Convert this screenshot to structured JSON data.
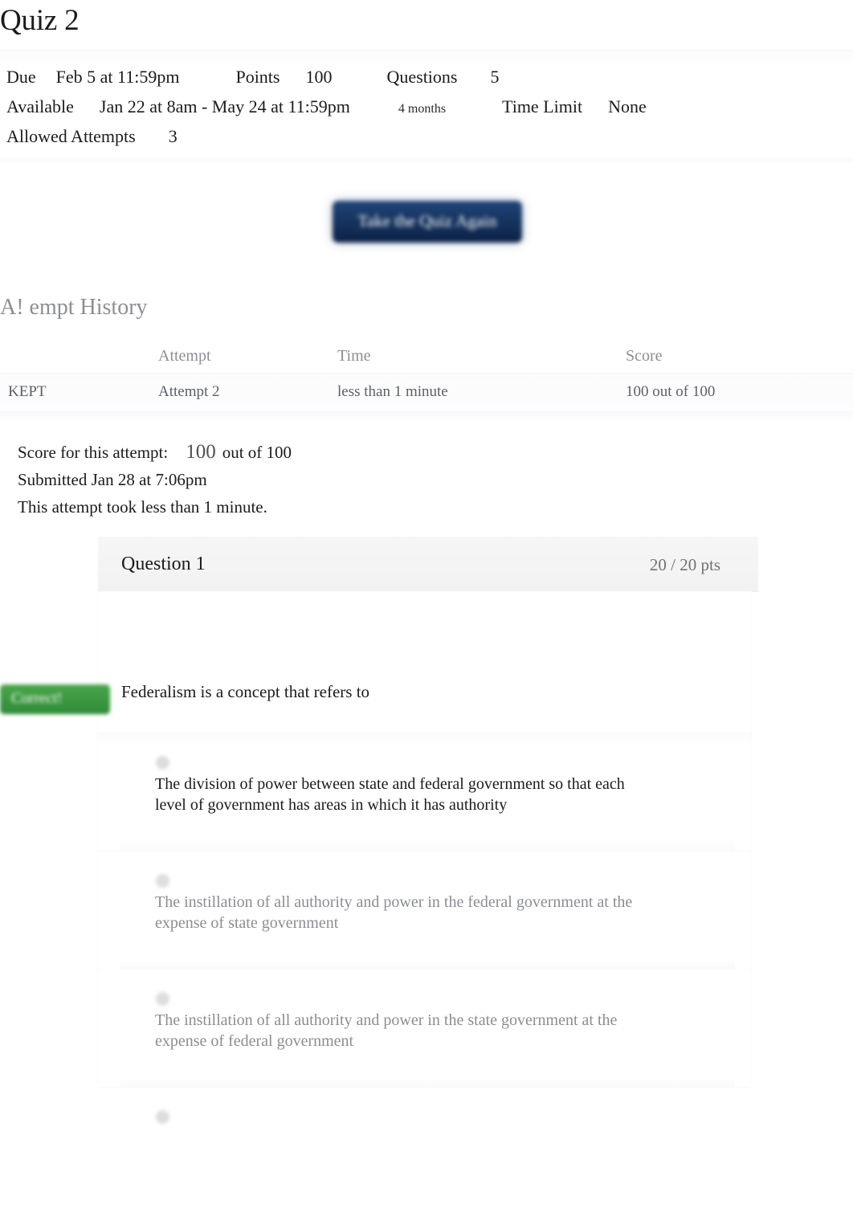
{
  "page": {
    "title": "Quiz 2"
  },
  "details": {
    "due_label": "Due",
    "due_value": "Feb 5 at 11:59pm",
    "points_label": "Points",
    "points_value": "100",
    "questions_label": "Questions",
    "questions_value": "5",
    "available_label": "Available",
    "available_value": "Jan 22 at 8am - May 24 at 11:59pm",
    "duration_note": "4 months",
    "time_limit_label": "Time Limit",
    "time_limit_value": "None",
    "allowed_attempts_label": "Allowed Attempts",
    "allowed_attempts_value": "3"
  },
  "actions": {
    "take_again_label": "Take the Quiz Again"
  },
  "attempt_history": {
    "heading": "A! empt History",
    "columns": {
      "status": "",
      "attempt": "Attempt",
      "time": "Time",
      "score": "Score"
    },
    "rows": [
      {
        "status": "KEPT",
        "attempt": "Attempt 2",
        "time": "less than 1 minute",
        "score": "100 out of 100"
      }
    ]
  },
  "attempt_summary": {
    "score_label": "Score for this attempt:",
    "score_value": "100",
    "score_suffix": "out of 100",
    "submitted": "Submitted Jan 28 at 7:06pm",
    "duration": "This attempt took less than 1 minute."
  },
  "question": {
    "number_label": "Question 1",
    "points": "20 / 20 pts",
    "prompt": "Federalism is a concept that refers to",
    "correct_badge": "Correct!",
    "answers": [
      {
        "text": "The division of power between state and federal government so that each level of government has areas in which it has authority",
        "selected": true
      },
      {
        "text": "The instillation of all authority and power in the federal government at the expense of state government",
        "selected": false
      },
      {
        "text": "The instillation of all authority and power in the state government at the expense of federal government",
        "selected": false
      },
      {
        "text": "",
        "selected": false
      }
    ]
  },
  "colors": {
    "button_navy": "#16355f",
    "correct_green": "#2e8b37",
    "link_blue": "#8fa0b8",
    "muted_gray": "#8b8f94"
  }
}
